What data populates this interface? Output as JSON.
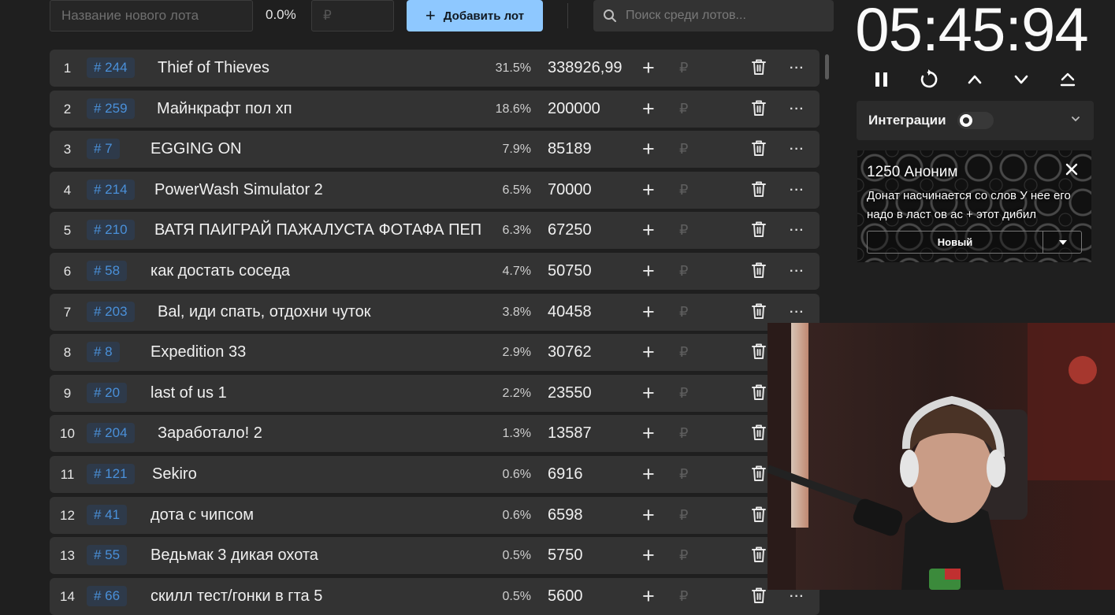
{
  "toolbar": {
    "name_placeholder": "Название нового лота",
    "percent": "0.0%",
    "amount_placeholder": "₽",
    "add_button": "Добавить лот",
    "search_placeholder": "Поиск среди лотов..."
  },
  "lots": [
    {
      "index": "1",
      "id": "# 244",
      "title": "Thief of Thieves",
      "percent": "31.5%",
      "amount": "338926,99"
    },
    {
      "index": "2",
      "id": "# 259",
      "title": "Майнкрафт пол хп",
      "percent": "18.6%",
      "amount": "200000"
    },
    {
      "index": "3",
      "id": "# 7",
      "title": "EGGING ON",
      "percent": "7.9%",
      "amount": "85189"
    },
    {
      "index": "4",
      "id": "# 214",
      "title": "PowerWash Simulator 2",
      "percent": "6.5%",
      "amount": "70000"
    },
    {
      "index": "5",
      "id": "# 210",
      "title": "ВАТЯ ПАИГРАЙ ПАЖАЛУСТА ФОТАФА ПЕП",
      "percent": "6.3%",
      "amount": "67250"
    },
    {
      "index": "6",
      "id": "# 58",
      "title": "как достать соседа",
      "percent": "4.7%",
      "amount": "50750"
    },
    {
      "index": "7",
      "id": "# 203",
      "title": "Bal, иди спать, отдохни чуток",
      "percent": "3.8%",
      "amount": "40458"
    },
    {
      "index": "8",
      "id": "# 8",
      "title": "Expedition 33",
      "percent": "2.9%",
      "amount": "30762"
    },
    {
      "index": "9",
      "id": "# 20",
      "title": "last of us 1",
      "percent": "2.2%",
      "amount": "23550"
    },
    {
      "index": "10",
      "id": "# 204",
      "title": "Заработало! 2",
      "percent": "1.3%",
      "amount": "13587"
    },
    {
      "index": "11",
      "id": "# 121",
      "title": "Sekiro",
      "percent": "0.6%",
      "amount": "6916"
    },
    {
      "index": "12",
      "id": "# 41",
      "title": "дота с чипсом",
      "percent": "0.6%",
      "amount": "6598"
    },
    {
      "index": "13",
      "id": "# 55",
      "title": "Ведьмак 3 дикая охота",
      "percent": "0.5%",
      "amount": "5750"
    },
    {
      "index": "14",
      "id": "# 66",
      "title": "скилл тест/гонки в гта 5",
      "percent": "0.5%",
      "amount": "5600"
    }
  ],
  "row_labels": {
    "plus": "+",
    "currency": "₽",
    "more": "···"
  },
  "timer": {
    "value": "05:45:94"
  },
  "integrations": {
    "label": "Интеграции",
    "enabled": false
  },
  "donation": {
    "header": "1250 Аноним",
    "message": "Донат насчинается со слов У нее его надо в ласт ов ас + этот дибил",
    "status": "Новый"
  },
  "colors": {
    "background": "#1f1f1f",
    "row": "#333333",
    "accent_button": "#8ec8ff",
    "lot_id": "#4a90d9"
  }
}
